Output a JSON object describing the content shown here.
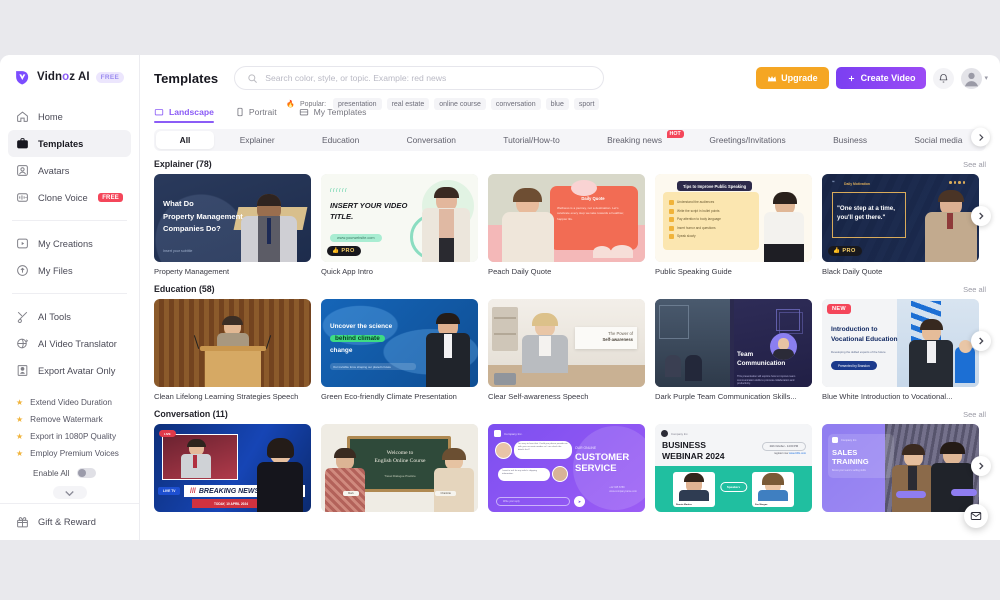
{
  "brand": {
    "name_1": "Vidn",
    "name_2": "o",
    "name_3": "z AI",
    "full": "Vidnoz AI",
    "badge": "FREE"
  },
  "sidebar": {
    "nav_primary": [
      {
        "label": "Home",
        "icon": "home-icon"
      },
      {
        "label": "Templates",
        "icon": "templates-icon",
        "active": true
      },
      {
        "label": "Avatars",
        "icon": "avatar-icon"
      },
      {
        "label": "Clone Voice",
        "icon": "voice-icon",
        "badge": "FREE"
      }
    ],
    "nav_secondary": [
      {
        "label": "My Creations",
        "icon": "play-box-icon"
      },
      {
        "label": "My Files",
        "icon": "upload-icon"
      }
    ],
    "nav_tools": [
      {
        "label": "AI Tools",
        "icon": "tools-icon"
      },
      {
        "label": "AI Video Translator",
        "icon": "translate-icon"
      },
      {
        "label": "Export Avatar Only",
        "icon": "export-avatar-icon"
      }
    ],
    "perks": [
      "Extend Video Duration",
      "Remove Watermark",
      "Export in 1080P Quality",
      "Employ Premium Voices"
    ],
    "enable_all_label": "Enable All",
    "gift_label": "Gift & Reward"
  },
  "header": {
    "title": "Templates",
    "search_placeholder": "Search color, style, or topic. Example: red news",
    "search_value": "",
    "popular_label": "Popular:",
    "popular_tags": [
      "presentation",
      "real estate",
      "online course",
      "conversation",
      "blue",
      "sport"
    ],
    "upgrade_label": "Upgrade",
    "create_label": "Create Video"
  },
  "view_tabs": [
    {
      "label": "Landscape",
      "icon": "landscape-icon",
      "active": true
    },
    {
      "label": "Portrait",
      "icon": "portrait-icon",
      "active": false
    },
    {
      "label": "My Templates",
      "icon": "my-templates-icon",
      "active": false
    }
  ],
  "categories": [
    {
      "label": "All",
      "active": true
    },
    {
      "label": "Explainer",
      "active": false
    },
    {
      "label": "Education",
      "active": false
    },
    {
      "label": "Conversation",
      "active": false
    },
    {
      "label": "Tutorial/How-to",
      "active": false
    },
    {
      "label": "Breaking news",
      "active": false,
      "badge": "HOT"
    },
    {
      "label": "Greetings/Invitations",
      "active": false
    },
    {
      "label": "Business",
      "active": false
    },
    {
      "label": "Social media",
      "active": false
    }
  ],
  "see_all_label": "See all",
  "sections": [
    {
      "title": "Explainer (78)",
      "cards": [
        {
          "title": "Property Management",
          "art": "property",
          "badge": ""
        },
        {
          "title": "Quick App Intro",
          "art": "appintro",
          "badge": "PRO"
        },
        {
          "title": "Peach Daily Quote",
          "art": "peach",
          "badge": ""
        },
        {
          "title": "Public Speaking Guide",
          "art": "speaking",
          "badge": ""
        },
        {
          "title": "Black Daily Quote",
          "art": "blackquote",
          "badge": "PRO"
        }
      ]
    },
    {
      "title": "Education (58)",
      "cards": [
        {
          "title": "Clean Lifelong Learning Strategies Speech",
          "art": "podium",
          "badge": ""
        },
        {
          "title": "Green Eco-friendly Climate Presentation",
          "art": "climate",
          "badge": ""
        },
        {
          "title": "Clear Self-awareness Speech",
          "art": "selfaware",
          "badge": ""
        },
        {
          "title": "Dark Purple Team Communication Skills...",
          "art": "team",
          "badge": ""
        },
        {
          "title": "Blue White Introduction to Vocational...",
          "art": "vocational",
          "badge": "NEW"
        }
      ]
    },
    {
      "title": "Conversation (11)",
      "cards": [
        {
          "title": "",
          "art": "breakingnews",
          "badge": ""
        },
        {
          "title": "",
          "art": "english",
          "badge": ""
        },
        {
          "title": "",
          "art": "customer",
          "badge": ""
        },
        {
          "title": "",
          "art": "webinar",
          "badge": ""
        },
        {
          "title": "",
          "art": "sales",
          "badge": ""
        }
      ]
    }
  ],
  "thumb_text": {
    "property": {
      "l1": "What Do",
      "l2": "Property Management",
      "l3": "Companies Do?",
      "sub": "Insert your subtitle"
    },
    "appintro": {
      "l1": "INSERT YOUR VIDEO",
      "l2": "TITLE.",
      "url": "www.yourwebsite.com"
    },
    "peach": {
      "head": "Daily Quote",
      "body": "Wellness is a journey, not a destination. Let's celebrate every step we take towards a healthier, happier life."
    },
    "speaking": {
      "head": "Tips to Improve Public Speaking",
      "b1": "Understand the audiences",
      "b2": "Write the script in bullet points",
      "b3": "Pay attention to body language",
      "b4": "Insert humor and questions",
      "b5": "Speak slowly"
    },
    "blackquote": {
      "tag": "Daily Motivation",
      "q1": "\"One step at a time,",
      "q2": "you'll get there.\""
    },
    "climate": {
      "l1": "Uncover the science",
      "l2": "behind climate",
      "l3": "change",
      "sub": "Our invisible force shaping our planet's future"
    },
    "selfaware": {
      "l1": "The Power of",
      "l2": "Self-awareness"
    },
    "team": {
      "l1": "Team",
      "l2": "Communication",
      "sub": "This presentation will explore how to improve team communication skills to promote collaboration and productivity."
    },
    "vocational": {
      "l1": "Introduction to",
      "l2": "Vocational Education",
      "sub": "Developing the skilled experts of the future",
      "chip": "Presented by Brandon"
    },
    "breakingnews": {
      "live": "LIVE",
      "tv": "LIVE TV",
      "head": "BREAKING NEWS",
      "date": "TODAY, 10 APRIL 2024"
    },
    "english": {
      "l1": "Welcome to",
      "l2": "English Online Course",
      "sub": "Travel Dialogue Practice",
      "n1": "Mark",
      "n2": "Charlotte"
    },
    "customer": {
      "brand": "Company Inc.",
      "l1": "OUR ONLINE",
      "l2": "CUSTOMER",
      "l3": "SERVICE",
      "phone": "+12 345 6789",
      "site": "www.companyname.com",
      "b1": "I'm sorry to hear that. Could you please provide me with your account number so I can check the details first?",
      "b2": "I want to ask for my order's shipping information.",
      "input": "Write your reply"
    },
    "webinar": {
      "brand": "Company Inc.",
      "l1": "BUSINESS",
      "l2": "WEBINAR 2024",
      "date": "24th October - 14:00 PM",
      "reg": "register now",
      "link": "www.URL.com",
      "speakers": "Speakers",
      "s1": "Ronnie Martins",
      "s1r": "Founder & CEO",
      "s2": "Zoe Morgan",
      "s2r": "Videographer"
    },
    "sales": {
      "brand": "Company Inc.",
      "l1": "SALES",
      "l2": "TRAINING",
      "sub": "Boost your team's selling skills"
    }
  }
}
